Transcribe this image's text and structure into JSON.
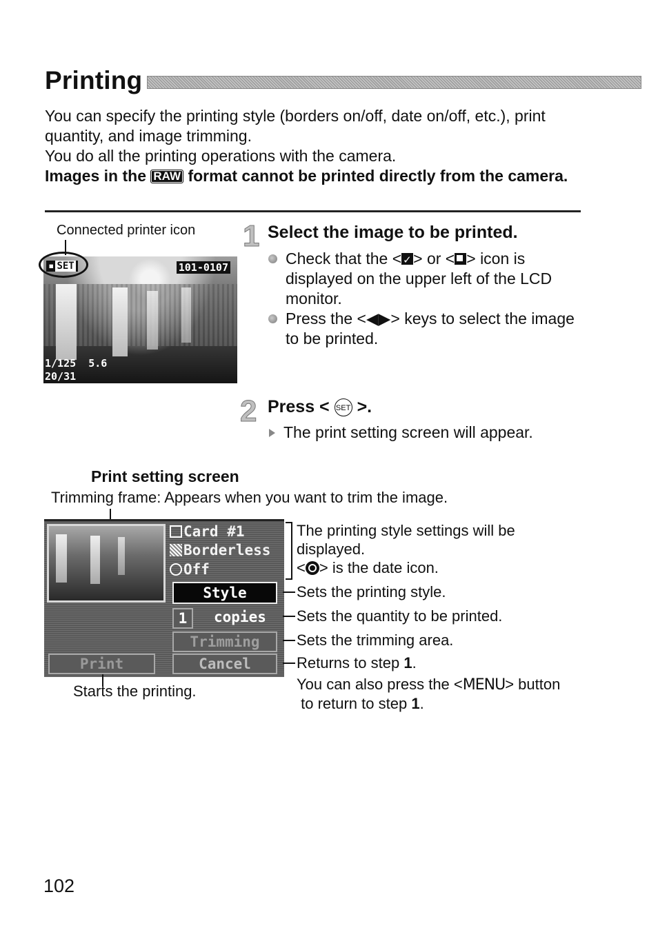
{
  "page": {
    "title": "Printing",
    "page_number": "102"
  },
  "intro": {
    "line1": "You can specify the printing style (borders on/off, date on/off, etc.), print quantity, and image trimming.",
    "line2": "You do all the printing operations with the camera.",
    "warning_before": "Images in the",
    "warning_badge": "RAW",
    "warning_after": "format cannot be printed directly from the camera."
  },
  "lcd_playback": {
    "caption": "Connected printer icon",
    "set_label": "SET",
    "file_number": "101-0107",
    "shutter_aperture": "1/125  5.6",
    "frame_counter": "20/31"
  },
  "step1": {
    "number": "1",
    "title": "Select the image to be printed.",
    "bullet1_before": "Check that the <",
    "bullet1_middle": "> or <",
    "bullet1_after": "> icon is displayed on the upper left of the LCD monitor.",
    "bullet2_before": "Press the <",
    "bullet2_keys": "◀▶",
    "bullet2_after": "> keys to select the image to be printed."
  },
  "step2": {
    "number": "2",
    "title_before": "Press <",
    "set_button": "SET",
    "title_after": ">.",
    "result": "The print setting screen will appear."
  },
  "print_setting_screen": {
    "heading": "Print setting screen",
    "trimming_frame_note": "Trimming frame: Appears when you want to trim the image.",
    "settings": {
      "card": "Card #1",
      "border": "Borderless",
      "date": "Off"
    },
    "buttons": {
      "style": "Style",
      "quantity": "1",
      "copies_label": "copies",
      "trimming": "Trimming",
      "cancel": "Cancel",
      "print": "Print"
    },
    "annotations": {
      "settings_line1": "The printing style settings will be",
      "settings_line2": "displayed.",
      "date_icon_before": "<",
      "date_icon_after": "> is the date icon.",
      "style": "Sets the printing style.",
      "quantity": "Sets the quantity to be printed.",
      "trimming": "Sets the trimming area.",
      "cancel_before": "Returns to step ",
      "cancel_step": "1",
      "cancel_after": ".",
      "menu_before": "You can also press the <",
      "menu_word": "MENU",
      "menu_after": "> button",
      "menu_line2_before": " to return to step ",
      "menu_line2_step": "1",
      "menu_line2_after": ".",
      "print": "Starts the printing."
    }
  }
}
